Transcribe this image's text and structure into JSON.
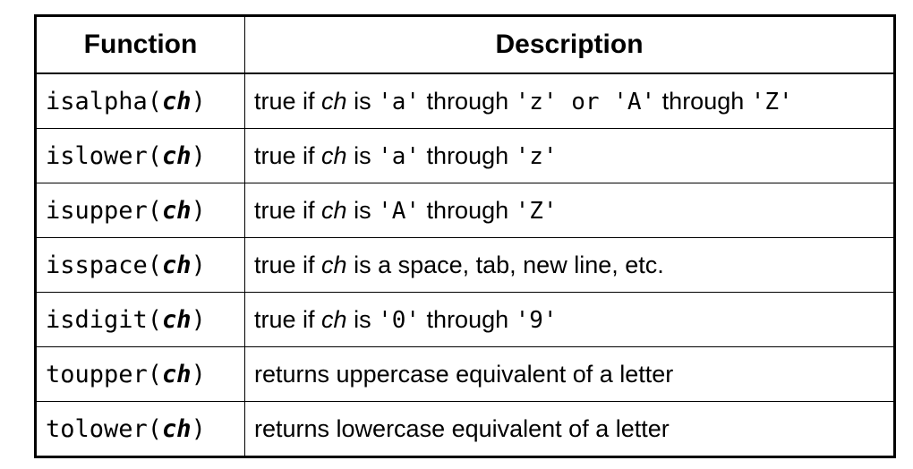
{
  "table": {
    "headers": {
      "function": "Function",
      "description": "Description"
    },
    "rows": [
      {
        "fn_name": "isalpha(",
        "fn_arg": "ch",
        "fn_close": ")",
        "desc": [
          {
            "t": "text",
            "v": "true if "
          },
          {
            "t": "ital",
            "v": "ch"
          },
          {
            "t": "text",
            "v": " is "
          },
          {
            "t": "code",
            "v": "'a'"
          },
          {
            "t": "text",
            "v": " through "
          },
          {
            "t": "code",
            "v": "'z' or 'A'"
          },
          {
            "t": "text",
            "v": " through "
          },
          {
            "t": "code",
            "v": "'Z'"
          }
        ]
      },
      {
        "fn_name": "islower(",
        "fn_arg": "ch",
        "fn_close": ")",
        "desc": [
          {
            "t": "text",
            "v": "true if "
          },
          {
            "t": "ital",
            "v": "ch"
          },
          {
            "t": "text",
            "v": " is "
          },
          {
            "t": "code",
            "v": "'a'"
          },
          {
            "t": "text",
            "v": " through "
          },
          {
            "t": "code",
            "v": "'z'"
          }
        ]
      },
      {
        "fn_name": "isupper(",
        "fn_arg": "ch",
        "fn_close": ")",
        "desc": [
          {
            "t": "text",
            "v": "true if "
          },
          {
            "t": "ital",
            "v": "ch"
          },
          {
            "t": "text",
            "v": " is "
          },
          {
            "t": "code",
            "v": "'A'"
          },
          {
            "t": "text",
            "v": " through "
          },
          {
            "t": "code",
            "v": "'Z'"
          }
        ]
      },
      {
        "fn_name": "isspace(",
        "fn_arg": "ch",
        "fn_close": ")",
        "desc": [
          {
            "t": "text",
            "v": "true if "
          },
          {
            "t": "ital",
            "v": "ch"
          },
          {
            "t": "text",
            "v": " is a space, tab, new line, etc."
          }
        ]
      },
      {
        "fn_name": "isdigit(",
        "fn_arg": "ch",
        "fn_close": ")",
        "desc": [
          {
            "t": "text",
            "v": "true if "
          },
          {
            "t": "ital",
            "v": "ch"
          },
          {
            "t": "text",
            "v": " is "
          },
          {
            "t": "code",
            "v": "'0'"
          },
          {
            "t": "text",
            "v": " through "
          },
          {
            "t": "code",
            "v": "'9'"
          }
        ]
      },
      {
        "fn_name": "toupper(",
        "fn_arg": "ch",
        "fn_close": ")",
        "desc": [
          {
            "t": "text",
            "v": "returns uppercase equivalent of a letter"
          }
        ]
      },
      {
        "fn_name": "tolower(",
        "fn_arg": "ch",
        "fn_close": ")",
        "desc": [
          {
            "t": "text",
            "v": "returns lowercase equivalent of a letter"
          }
        ]
      }
    ]
  }
}
